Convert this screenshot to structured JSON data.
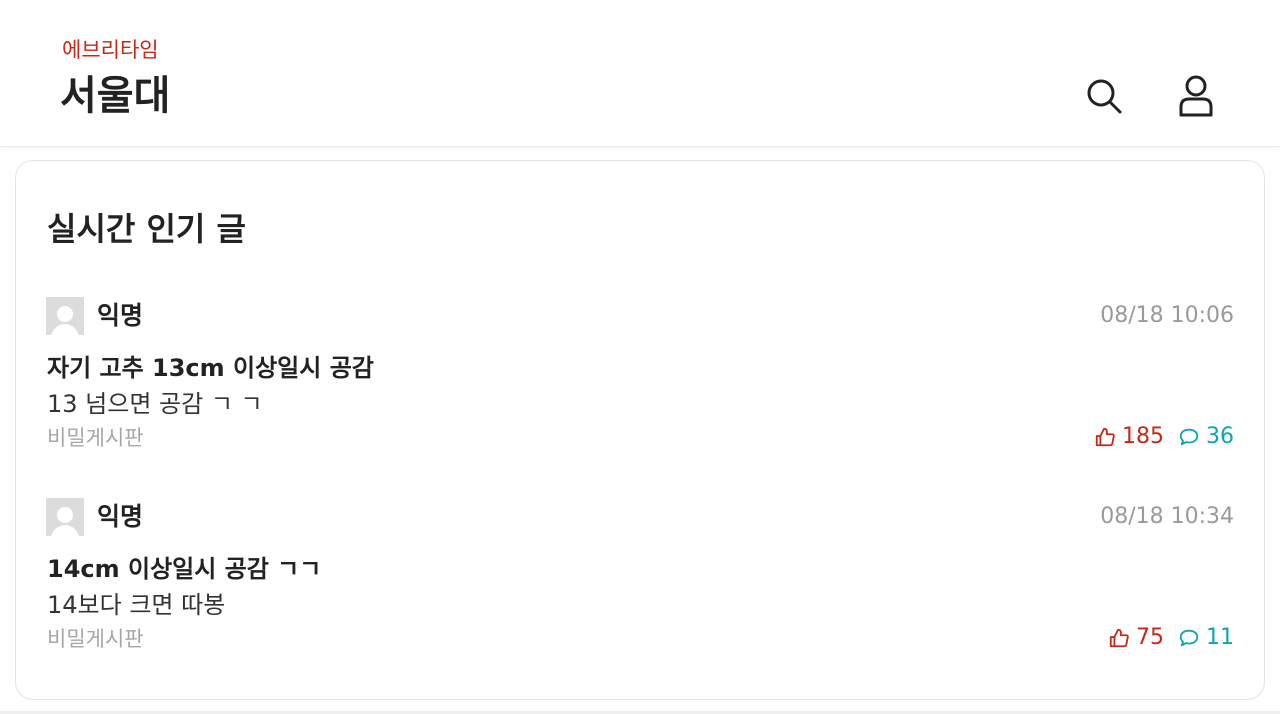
{
  "header": {
    "brand": "에브리타임",
    "school": "서울대",
    "search_icon": "search-icon",
    "profile_icon": "user-icon"
  },
  "section": {
    "title": "실시간 인기 글"
  },
  "posts": [
    {
      "author": "익명",
      "time": "08/18 10:06",
      "title": "자기 고추 13cm 이상일시 공감",
      "body": "13 넘으면 공감 ㄱ ㄱ",
      "board": "비밀게시판",
      "likes": "185",
      "comments": "36"
    },
    {
      "author": "익명",
      "time": "08/18 10:34",
      "title": "14cm 이상일시 공감 ㄱㄱ",
      "body": "14보다 크면 따봉",
      "board": "비밀게시판",
      "likes": "75",
      "comments": "11"
    }
  ],
  "colors": {
    "brand": "#c62917",
    "like": "#c62917",
    "comment": "#0ca5b0"
  }
}
